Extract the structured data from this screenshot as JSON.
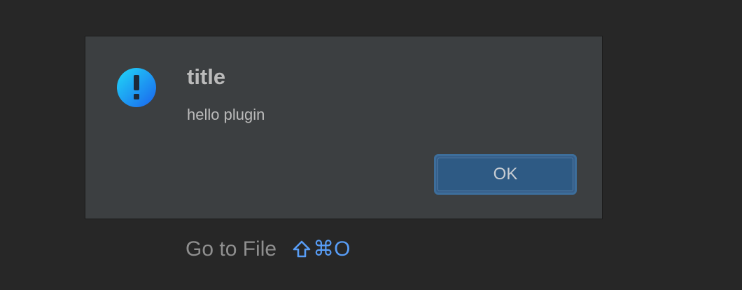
{
  "dialog": {
    "title": "title",
    "message": "hello plugin",
    "ok_label": "OK",
    "icon": "info-exclamation-icon"
  },
  "hint": {
    "label": "Go to File",
    "shortcut_keys": "⌘O",
    "shortcut_modifier_icon": "shift-icon"
  },
  "colors": {
    "background": "#272727",
    "dialog_background": "#3c3f41",
    "button_background": "#2e5a84",
    "shortcut_accent": "#589df6"
  }
}
